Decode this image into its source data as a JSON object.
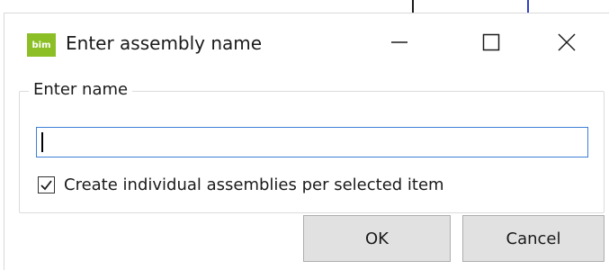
{
  "window": {
    "title": "Enter assembly name",
    "app_icon_text": "bim",
    "app_icon_color": "#8cbf26"
  },
  "group": {
    "legend": "Enter name"
  },
  "name_field": {
    "value": "",
    "placeholder": ""
  },
  "checkbox": {
    "label": "Create individual assemblies per selected item",
    "checked": true
  },
  "buttons": {
    "ok": "OK",
    "cancel": "Cancel"
  },
  "colors": {
    "input_border": "#3d7fd4",
    "button_bg": "#e1e1e1"
  }
}
